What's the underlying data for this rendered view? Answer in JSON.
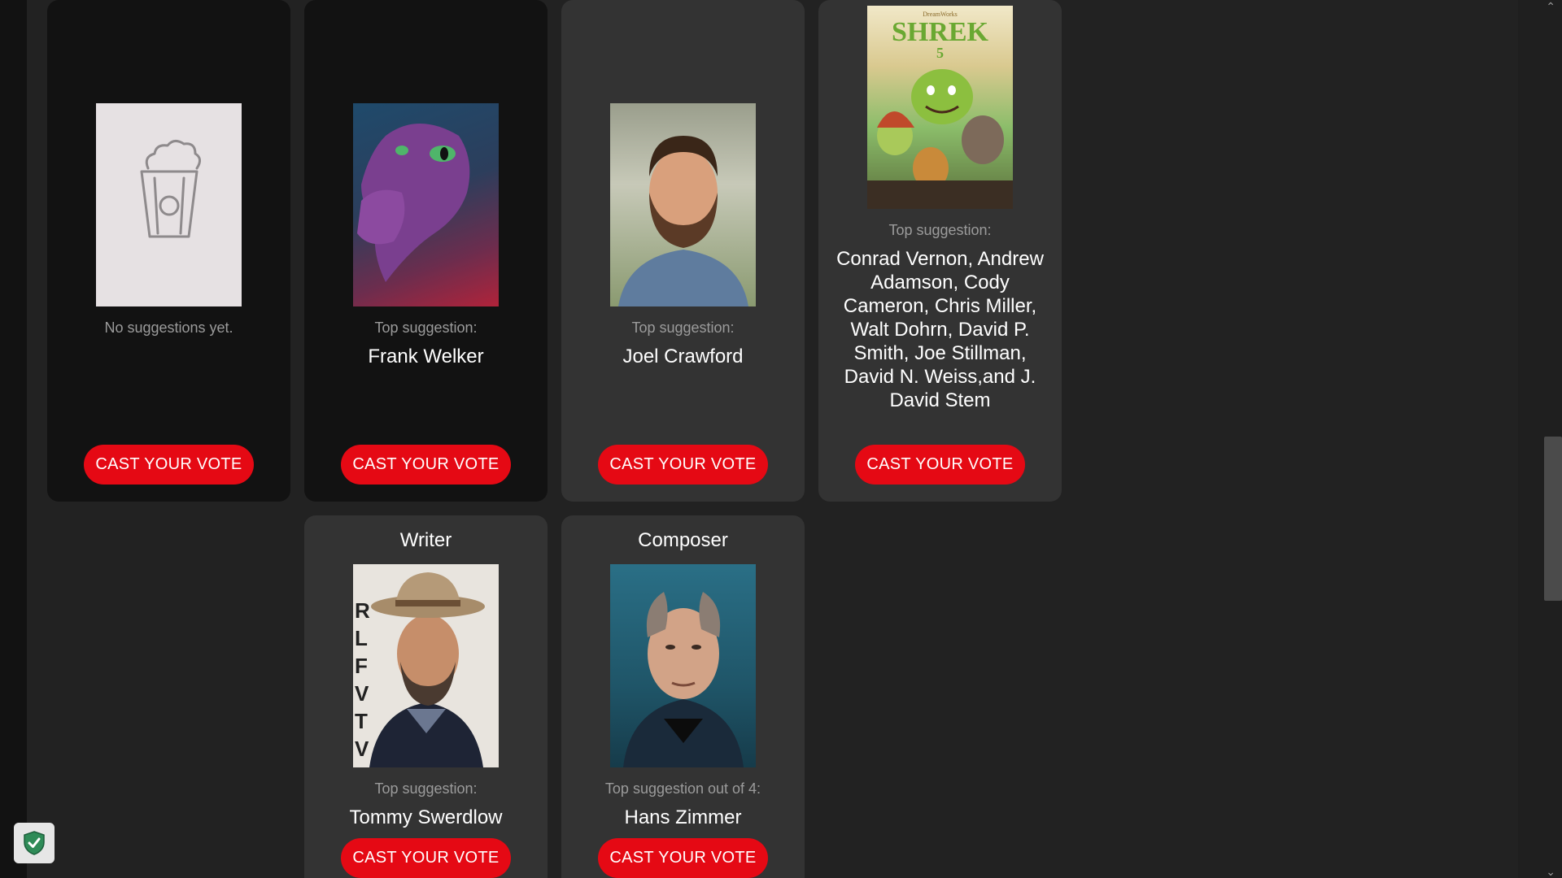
{
  "cards_row1": [
    {
      "style": "dark",
      "image": "popcorn-placeholder-icon",
      "top_label": "No suggestions yet.",
      "top_name": "",
      "button_label": "CAST YOUR VOTE"
    },
    {
      "style": "dark",
      "image": "purple-dragon-portrait",
      "top_label": "Top suggestion:",
      "top_name": "Frank Welker",
      "button_label": "CAST YOUR VOTE"
    },
    {
      "style": "grey",
      "image": "bearded-man-portrait",
      "top_label": "Top suggestion:",
      "top_name": "Joel Crawford",
      "button_label": "CAST YOUR VOTE"
    },
    {
      "style": "grey",
      "image": "shrek-5-poster",
      "poster_title": "SHREK",
      "poster_number": "5",
      "poster_brand": "DreamWorks",
      "top_label": "Top suggestion:",
      "top_name": "Conrad Vernon, Andrew Adamson, Cody Cameron, Chris Miller, Walt Dohrn, David P. Smith, Joe Stillman, David N. Weiss,and J. David Stem",
      "button_label": "CAST YOUR VOTE"
    }
  ],
  "cards_row2": [
    {
      "style": "grey",
      "title": "Writer",
      "image": "man-in-hat-portrait",
      "backdrop_letters": "R L F V T V",
      "top_label": "Top suggestion:",
      "top_name": "Tommy Swerdlow",
      "button_label": "CAST YOUR VOTE"
    },
    {
      "style": "grey",
      "title": "Composer",
      "image": "composer-portrait",
      "top_label": "Top suggestion out of 4:",
      "top_name": "Hans Zimmer",
      "button_label": "CAST YOUR VOTE"
    }
  ],
  "colors": {
    "vote_button": "#e50914",
    "card_dark": "#121212",
    "card_grey": "#333333",
    "page_bg": "#222222",
    "label_grey": "#9b9b9b"
  },
  "badge": {
    "icon": "shield-check-icon"
  },
  "scrollbar": {
    "up_icon": "chevron-up-icon",
    "down_icon": "chevron-down-icon"
  }
}
